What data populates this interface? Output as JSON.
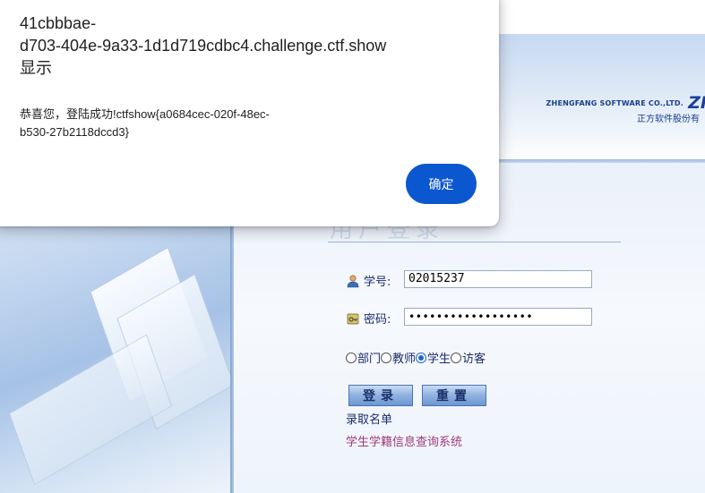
{
  "header": {
    "brand_en": "ZHENGFANG SOFTWARE CO.,LTD.",
    "brand_zh": "正方软件股份有",
    "brand_mark": "ZI"
  },
  "login": {
    "title": "用户登录",
    "student_id_label": "学号:",
    "student_id_value": "02015237",
    "password_label": "密码:",
    "password_value": "••••••••••••••••••",
    "roles": [
      {
        "label": "部门",
        "checked": false
      },
      {
        "label": "教师",
        "checked": false
      },
      {
        "label": "学生",
        "checked": true
      },
      {
        "label": "访客",
        "checked": false
      }
    ],
    "login_button": "登录",
    "reset_button": "重置",
    "link_admission": "录取名单",
    "link_status": "学生学籍信息查询系统"
  },
  "dialog": {
    "host_line1": "41cbbbae-",
    "host_line2": "d703-404e-9a33-1d1d719cdbc4.challenge.ctf.show",
    "host_line3": "显示",
    "message_line1": "恭喜您，登陆成功!ctfshow{a0684cec-020f-48ec-",
    "message_line2": "b530-27b2118dccd3}",
    "ok_button": "确定"
  },
  "colors": {
    "dialog_button": "#0b57d0",
    "link_status": "#a0397d",
    "text_navy": "#1d2c6b"
  },
  "icons": {
    "user": "user-icon",
    "key": "key-icon"
  }
}
